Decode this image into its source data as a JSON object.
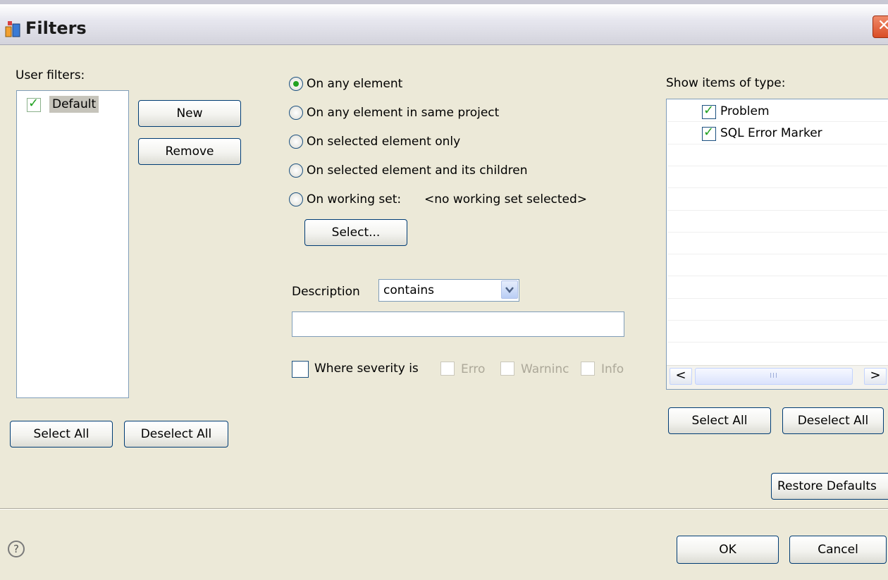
{
  "window": {
    "title": "Filters",
    "close_icon": "close-icon",
    "app_icon": "filter-app-icon"
  },
  "user_filters": {
    "label": "User filters:",
    "items": [
      {
        "label": "Default",
        "checked": true,
        "selected": true
      }
    ],
    "new_label": "New",
    "remove_label": "Remove",
    "select_all_label": "Select All",
    "deselect_all_label": "Deselect All"
  },
  "scope": {
    "options": [
      {
        "label": "On any element",
        "selected": true
      },
      {
        "label": "On any element in same project",
        "selected": false
      },
      {
        "label": "On selected element only",
        "selected": false
      },
      {
        "label": "On selected element and its children",
        "selected": false
      },
      {
        "label": "On working set:",
        "selected": false
      }
    ],
    "working_set_value": "<no working set selected>",
    "select_button_label": "Select..."
  },
  "description": {
    "label": "Description",
    "operator_value": "contains",
    "text_value": ""
  },
  "severity": {
    "label": "Where severity is",
    "checked": false,
    "levels": [
      "Error",
      "Warning",
      "Info"
    ],
    "levels_visible": [
      "Erro",
      "Warninc",
      "Info"
    ]
  },
  "types": {
    "label": "Show items of type:",
    "items": [
      {
        "label": "Problem",
        "checked": true
      },
      {
        "label": "SQL Error Marker",
        "checked": true
      }
    ],
    "select_all_label": "Select All",
    "deselect_all_label": "Deselect All",
    "scroll_thumb_grip": "III"
  },
  "footer": {
    "restore_defaults_label": "Restore Defaults",
    "ok_label": "OK",
    "cancel_label": "Cancel",
    "help_icon": "help-icon"
  },
  "colors": {
    "dialog_bg": "#ece9d8",
    "button_border": "#003c74",
    "check_green": "#21a121",
    "field_border": "#7f9db9"
  }
}
